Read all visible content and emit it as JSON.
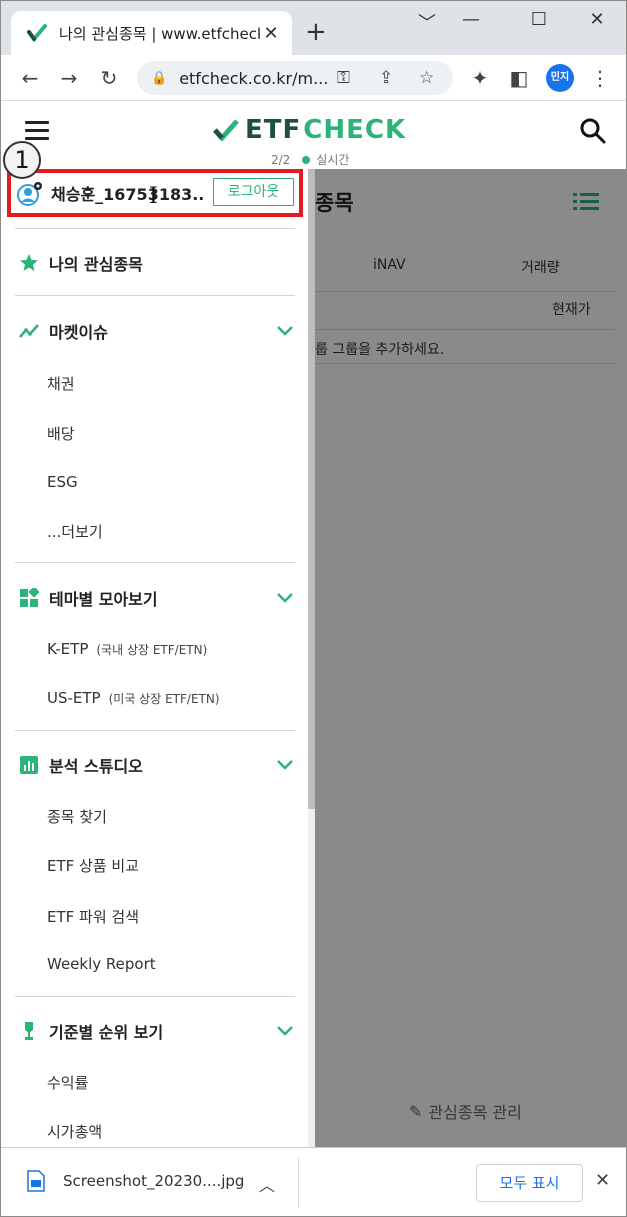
{
  "browser": {
    "tab_title": "나의 관심종목 | www.etfcheck",
    "tab_close": "✕",
    "new_tab": "+",
    "url": "etfcheck.co.kr/m...",
    "profile_label": "민지",
    "window_minimize": "﹀",
    "window_min": "—",
    "window_max": "☐",
    "window_close": "✕"
  },
  "header": {
    "logo_etf": "ETF",
    "logo_check": "CHECK",
    "page_counter": "2/2",
    "realtime_label": "실시간"
  },
  "main": {
    "title": "종목",
    "columns": [
      "iNAV",
      "거래량"
    ],
    "sub_column": "현재가",
    "empty_message": "룹 그룹을 추가하세요.",
    "manage_label": "관심종목 관리"
  },
  "drawer": {
    "user_name": "채승훈_16753183...",
    "logout_label": "로그아웃",
    "step_badge": "1",
    "favorites_label": "나의 관심종목",
    "sections": [
      {
        "label": "마켓이슈",
        "items": [
          "채권",
          "배당",
          "ESG",
          "...더보기"
        ]
      },
      {
        "label": "테마별 모아보기",
        "items": [
          "K-ETP",
          "US-ETP"
        ],
        "notes": [
          "(국내 상장 ETF/ETN)",
          "(미국 상장 ETF/ETN)"
        ]
      },
      {
        "label": "분석 스튜디오",
        "items": [
          "종목 찾기",
          "ETF 상품 비교",
          "ETF 파워 검색",
          "Weekly Report"
        ]
      },
      {
        "label": "기준별 순위 보기",
        "items": [
          "수익률",
          "시가총액"
        ]
      }
    ]
  },
  "download_bar": {
    "file_name": "Screenshot_20230....jpg",
    "show_all_label": "모두 표시",
    "close": "✕"
  },
  "colors": {
    "accent": "#2cb37a",
    "logo_dark": "#1d4f43",
    "highlight_box": "#e31b23",
    "link_blue": "#1a73e8"
  }
}
